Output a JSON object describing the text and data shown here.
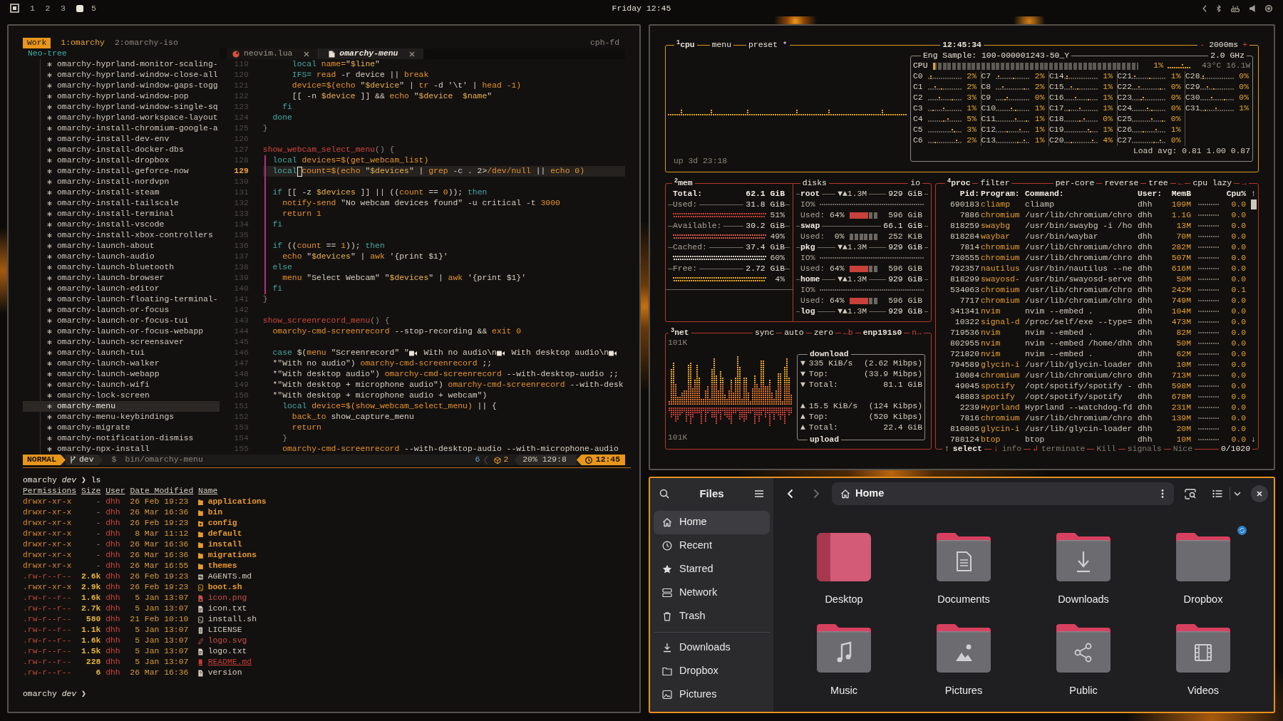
{
  "top_bar": {
    "workspaces": [
      {
        "label": "1",
        "selected": false
      },
      {
        "label": "2",
        "selected": false
      },
      {
        "label": "3",
        "selected": false
      },
      {
        "selected": true
      },
      {
        "label": "5",
        "selected": false
      }
    ],
    "clock": "Friday 12:45"
  },
  "tmux": {
    "session": "Work",
    "windows": [
      {
        "label": "1:omarchy",
        "selected": true
      },
      {
        "label": "2:omarchy-iso",
        "selected": false
      }
    ],
    "host": "cph-fd"
  },
  "neo_tree": {
    "title": "Neo-tree",
    "items": [
      {
        "name": "omarchy-hyprland-monitor-scaling-",
        "selected": false
      },
      {
        "name": "omarchy-hyprland-window-close-all",
        "selected": false
      },
      {
        "name": "omarchy-hyprland-window-gaps-togg",
        "selected": false
      },
      {
        "name": "omarchy-hyprland-window-pop",
        "selected": false
      },
      {
        "name": "omarchy-hyprland-window-single-sq",
        "selected": false
      },
      {
        "name": "omarchy-hyprland-workspace-layout",
        "selected": false
      },
      {
        "name": "omarchy-install-chromium-google-a",
        "selected": false
      },
      {
        "name": "omarchy-install-dev-env",
        "selected": false
      },
      {
        "name": "omarchy-install-docker-dbs",
        "selected": false
      },
      {
        "name": "omarchy-install-dropbox",
        "selected": false
      },
      {
        "name": "omarchy-install-geforce-now",
        "selected": false
      },
      {
        "name": "omarchy-install-nordvpn",
        "selected": false
      },
      {
        "name": "omarchy-install-steam",
        "selected": false
      },
      {
        "name": "omarchy-install-tailscale",
        "selected": false
      },
      {
        "name": "omarchy-install-terminal",
        "selected": false
      },
      {
        "name": "omarchy-install-vscode",
        "selected": false
      },
      {
        "name": "omarchy-install-xbox-controllers",
        "selected": false
      },
      {
        "name": "omarchy-launch-about",
        "selected": false
      },
      {
        "name": "omarchy-launch-audio",
        "selected": false
      },
      {
        "name": "omarchy-launch-bluetooth",
        "selected": false
      },
      {
        "name": "omarchy-launch-browser",
        "selected": false
      },
      {
        "name": "omarchy-launch-editor",
        "selected": false
      },
      {
        "name": "omarchy-launch-floating-terminal-",
        "selected": false
      },
      {
        "name": "omarchy-launch-or-focus",
        "selected": false
      },
      {
        "name": "omarchy-launch-or-focus-tui",
        "selected": false
      },
      {
        "name": "omarchy-launch-or-focus-webapp",
        "selected": false
      },
      {
        "name": "omarchy-launch-screensaver",
        "selected": false
      },
      {
        "name": "omarchy-launch-tui",
        "selected": false
      },
      {
        "name": "omarchy-launch-walker",
        "selected": false
      },
      {
        "name": "omarchy-launch-webapp",
        "selected": false
      },
      {
        "name": "omarchy-launch-wifi",
        "selected": false
      },
      {
        "name": "omarchy-lock-screen",
        "selected": false
      },
      {
        "name": "omarchy-menu",
        "selected": true
      },
      {
        "name": "omarchy-menu-keybindings",
        "selected": false
      },
      {
        "name": "omarchy-migrate",
        "selected": false
      },
      {
        "name": "omarchy-notification-dismiss",
        "selected": false
      },
      {
        "name": "omarchy-npx-install",
        "selected": false
      }
    ]
  },
  "editor": {
    "tabs": [
      {
        "label": "neovim.lua",
        "kind": "lua",
        "selected": false
      },
      {
        "label": "omarchy-menu",
        "kind": "shell",
        "selected": true
      }
    ],
    "lines": [
      {
        "number": "119",
        "current": false,
        "scope": false,
        "tokens": [
          {
            "kind": "kw",
            "text": "      local"
          },
          {
            "kind": "cmd",
            "text": " name="
          },
          {
            "kind": "txt",
            "text": "\""
          },
          {
            "kind": "var",
            "text": "$line"
          },
          {
            "kind": "txt",
            "text": "\""
          }
        ]
      },
      {
        "number": "120",
        "current": false,
        "scope": false,
        "tokens": [
          {
            "kind": "kw",
            "text": "      IFS="
          },
          {
            "kind": "cmd",
            "text": " read"
          },
          {
            "kind": "txt",
            "text": " -r device || "
          },
          {
            "kind": "cmd",
            "text": "break"
          }
        ]
      },
      {
        "number": "121",
        "current": false,
        "scope": false,
        "tokens": [
          {
            "kind": "cmd",
            "text": "      device=$(echo"
          },
          {
            "kind": "txt",
            "text": " \""
          },
          {
            "kind": "var",
            "text": "$device"
          },
          {
            "kind": "txt",
            "text": "\" | "
          },
          {
            "kind": "cmd",
            "text": "tr"
          },
          {
            "kind": "txt",
            "text": " -d '\\t' | "
          },
          {
            "kind": "cmd",
            "text": "head -1)"
          }
        ]
      },
      {
        "number": "122",
        "current": false,
        "scope": false,
        "tokens": [
          {
            "kind": "txt",
            "text": "      [[ -n "
          },
          {
            "kind": "var",
            "text": "$device"
          },
          {
            "kind": "txt",
            "text": " ]] && "
          },
          {
            "kind": "cmd",
            "text": "echo"
          },
          {
            "kind": "txt",
            "text": " \""
          },
          {
            "kind": "var",
            "text": "$device  $name"
          },
          {
            "kind": "txt",
            "text": "\""
          }
        ]
      },
      {
        "number": "123",
        "current": false,
        "scope": false,
        "tokens": [
          {
            "kind": "kw",
            "text": "    fi"
          }
        ]
      },
      {
        "number": "124",
        "current": false,
        "scope": false,
        "tokens": [
          {
            "kind": "kw",
            "text": "  done"
          }
        ]
      },
      {
        "number": "125",
        "current": false,
        "scope": false,
        "tokens": [
          {
            "kind": "dim",
            "text": "}"
          }
        ]
      },
      {
        "number": "126",
        "current": false,
        "scope": false
      },
      {
        "number": "127",
        "current": false,
        "scope": false,
        "tokens": [
          {
            "kind": "fn",
            "text": "show_webcam_select_menu"
          },
          {
            "kind": "dim",
            "text": "() {"
          }
        ]
      },
      {
        "number": "128",
        "current": false,
        "scope": true,
        "tokens": [
          {
            "kind": "kw",
            "text": "  local"
          },
          {
            "kind": "cmd",
            "text": " devices=$(get_webcam_list)"
          }
        ]
      },
      {
        "number": "129",
        "current": true,
        "scope": true,
        "tokens": [
          {
            "kind": "kw",
            "text": "  local"
          },
          {
            "kind": "cursor"
          },
          {
            "kind": "cmd",
            "text": "count=$(echo"
          },
          {
            "kind": "txt",
            "text": " \""
          },
          {
            "kind": "var",
            "text": "$devices"
          },
          {
            "kind": "txt",
            "text": "\" | "
          },
          {
            "kind": "cmd",
            "text": "grep"
          },
          {
            "kind": "txt",
            "text": " -c . 2>"
          },
          {
            "kind": "cmd",
            "text": "/dev/null"
          },
          {
            "kind": "txt",
            "text": " || "
          },
          {
            "kind": "cmd",
            "text": "echo 0)"
          }
        ]
      },
      {
        "number": "130",
        "current": false,
        "scope": true
      },
      {
        "number": "131",
        "current": false,
        "scope": true,
        "tokens": [
          {
            "kind": "kw",
            "text": "  if"
          },
          {
            "kind": "txt",
            "text": " [[ -z "
          },
          {
            "kind": "var",
            "text": "$devices"
          },
          {
            "kind": "txt",
            "text": " ]] || (("
          },
          {
            "kind": "cmd",
            "text": "count"
          },
          {
            "kind": "txt",
            "text": " == "
          },
          {
            "kind": "num",
            "text": "0"
          },
          {
            "kind": "txt",
            "text": "));"
          },
          {
            "kind": "kw",
            "text": " then"
          }
        ]
      },
      {
        "number": "132",
        "current": false,
        "scope": true,
        "tokens": [
          {
            "kind": "cmd",
            "text": "    notify-send"
          },
          {
            "kind": "txt",
            "text": " \"No webcam devices found\" -u critical -t "
          },
          {
            "kind": "num",
            "text": "3000"
          }
        ]
      },
      {
        "number": "133",
        "current": false,
        "scope": true,
        "tokens": [
          {
            "kind": "cmd",
            "text": "    return 1"
          }
        ]
      },
      {
        "number": "134",
        "current": false,
        "scope": true,
        "tokens": [
          {
            "kind": "kw",
            "text": "  fi"
          }
        ]
      },
      {
        "number": "135",
        "current": false,
        "scope": true
      },
      {
        "number": "136",
        "current": false,
        "scope": true,
        "tokens": [
          {
            "kind": "kw",
            "text": "  if"
          },
          {
            "kind": "txt",
            "text": " (("
          },
          {
            "kind": "cmd",
            "text": "count"
          },
          {
            "kind": "txt",
            "text": " == "
          },
          {
            "kind": "num",
            "text": "1"
          },
          {
            "kind": "txt",
            "text": "));"
          },
          {
            "kind": "kw",
            "text": " then"
          }
        ]
      },
      {
        "number": "137",
        "current": false,
        "scope": true,
        "tokens": [
          {
            "kind": "cmd",
            "text": "    echo"
          },
          {
            "kind": "txt",
            "text": " \""
          },
          {
            "kind": "var",
            "text": "$devices"
          },
          {
            "kind": "txt",
            "text": "\" | "
          },
          {
            "kind": "cmd",
            "text": "awk"
          },
          {
            "kind": "txt",
            "text": " '{print $1}'"
          }
        ]
      },
      {
        "number": "138",
        "current": false,
        "scope": true,
        "tokens": [
          {
            "kind": "kw",
            "text": "  else"
          }
        ]
      },
      {
        "number": "139",
        "current": false,
        "scope": true,
        "tokens": [
          {
            "kind": "cmd",
            "text": "    menu"
          },
          {
            "kind": "txt",
            "text": " \"Select Webcam\" \""
          },
          {
            "kind": "var",
            "text": "$devices"
          },
          {
            "kind": "txt",
            "text": "\" | "
          },
          {
            "kind": "cmd",
            "text": "awk"
          },
          {
            "kind": "txt",
            "text": " '{print $1}'"
          }
        ]
      },
      {
        "number": "140",
        "current": false,
        "scope": true,
        "tokens": [
          {
            "kind": "kw",
            "text": "  fi"
          }
        ]
      },
      {
        "number": "141",
        "current": false,
        "scope": false,
        "tokens": [
          {
            "kind": "dim",
            "text": "}"
          }
        ]
      },
      {
        "number": "142",
        "current": false,
        "scope": false
      },
      {
        "number": "143",
        "current": false,
        "scope": false,
        "tokens": [
          {
            "kind": "fn",
            "text": "show_screenrecord_menu"
          },
          {
            "kind": "dim",
            "text": "() {"
          }
        ]
      },
      {
        "number": "144",
        "current": false,
        "scope": false,
        "tokens": [
          {
            "kind": "cmd",
            "text": "  omarchy-cmd-screenrecord"
          },
          {
            "kind": "txt",
            "text": " --stop-recording && "
          },
          {
            "kind": "cmd",
            "text": "exit 0"
          }
        ]
      },
      {
        "number": "145",
        "current": false,
        "scope": false
      },
      {
        "number": "146",
        "current": false,
        "scope": false,
        "tokens": [
          {
            "kind": "kw",
            "text": "  case"
          },
          {
            "kind": "txt",
            "text": " $("
          },
          {
            "kind": "cmd",
            "text": "menu"
          },
          {
            "kind": "txt",
            "text": " \"Screenrecord\" \""
          },
          {
            "kind": "camera"
          },
          {
            "kind": "txt",
            "text": " With no audio\\n"
          },
          {
            "kind": "camera"
          },
          {
            "kind": "txt",
            "text": " With desktop audio\\n"
          },
          {
            "kind": "camera"
          }
        ]
      },
      {
        "number": "147",
        "current": false,
        "scope": false,
        "tokens": [
          {
            "kind": "txt",
            "text": "  *\"With no audio\")"
          },
          {
            "kind": "cmd",
            "text": " omarchy-cmd-screenrecord"
          },
          {
            "kind": "txt",
            "text": " ;;"
          }
        ]
      },
      {
        "number": "148",
        "current": false,
        "scope": false,
        "tokens": [
          {
            "kind": "txt",
            "text": "  *\"With desktop audio\")"
          },
          {
            "kind": "cmd",
            "text": " omarchy-cmd-screenrecord"
          },
          {
            "kind": "txt",
            "text": " --with-desktop-audio ;;"
          }
        ]
      },
      {
        "number": "149",
        "current": false,
        "scope": false,
        "tokens": [
          {
            "kind": "txt",
            "text": "  *\"With desktop + microphone audio\")"
          },
          {
            "kind": "cmd",
            "text": " omarchy-cmd-screenrecord"
          },
          {
            "kind": "txt",
            "text": " --with-desk"
          }
        ]
      },
      {
        "number": "150",
        "current": false,
        "scope": false,
        "tokens": [
          {
            "kind": "txt",
            "text": "  *\"With desktop + microphone audio + webcam\")"
          }
        ]
      },
      {
        "number": "151",
        "current": false,
        "scope": false,
        "tokens": [
          {
            "kind": "kw",
            "text": "    local"
          },
          {
            "kind": "cmd",
            "text": " device=$(show_webcam_select_menu)"
          },
          {
            "kind": "txt",
            "text": " || {"
          }
        ]
      },
      {
        "number": "152",
        "current": false,
        "scope": false,
        "tokens": [
          {
            "kind": "cmd",
            "text": "      back_to"
          },
          {
            "kind": "txt",
            "text": " show_capture_menu"
          }
        ]
      },
      {
        "number": "153",
        "current": false,
        "scope": false,
        "tokens": [
          {
            "kind": "cmd",
            "text": "      return"
          }
        ]
      },
      {
        "number": "154",
        "current": false,
        "scope": false,
        "tokens": [
          {
            "kind": "dim",
            "text": "    }"
          }
        ]
      },
      {
        "number": "155",
        "current": false,
        "scope": false,
        "tokens": [
          {
            "kind": "cmd",
            "text": "    omarchy-cmd-screenrecord"
          },
          {
            "kind": "txt",
            "text": " --with-desktop-audio --with-microphone-audio"
          }
        ]
      }
    ],
    "status_line": {
      "mode": "NORMAL",
      "branch": "dev",
      "file_icon": "$",
      "file": "bin/omarchy-menu",
      "diagnostics": "6",
      "packages": "2",
      "progress": "20%",
      "position": "129:8",
      "time": "12:45"
    }
  },
  "terminal": {
    "prompt": "omarchy *dev* ❯",
    "command": "ls",
    "columns": [
      "Permissions",
      "Size",
      "User",
      "Date Modified",
      "Name"
    ],
    "rows": [
      {
        "permissions": "drwxr-xr-x",
        "size": "-",
        "user": "dhh",
        "modified": "26 Feb 19:23",
        "name": "applications",
        "kind": "folder"
      },
      {
        "permissions": "drwxr-xr-x",
        "size": "-",
        "user": "dhh",
        "modified": "26 Mar 16:36",
        "name": "bin",
        "kind": "folder"
      },
      {
        "permissions": "drwxr-xr-x",
        "size": "-",
        "user": "dhh",
        "modified": "26 Feb 19:23",
        "name": "config",
        "kind": "config"
      },
      {
        "permissions": "drwxr-xr-x",
        "size": "-",
        "user": "dhh",
        "modified": "8 Mar 11:12",
        "name": "default",
        "kind": "folder"
      },
      {
        "permissions": "drwxr-xr-x",
        "size": "-",
        "user": "dhh",
        "modified": "26 Mar 16:36",
        "name": "install",
        "kind": "folder"
      },
      {
        "permissions": "drwxr-xr-x",
        "size": "-",
        "user": "dhh",
        "modified": "26 Mar 16:36",
        "name": "migrations",
        "kind": "folder"
      },
      {
        "permissions": "drwxr-xr-x",
        "size": "-",
        "user": "dhh",
        "modified": "26 Mar 16:55",
        "name": "themes",
        "kind": "folder"
      },
      {
        "permissions": ".rw-r--r--",
        "size": "2.6k",
        "user": "dhh",
        "modified": "26 Feb 19:23",
        "name": "AGENTS.md",
        "kind": "markdown"
      },
      {
        "permissions": ".rwxr-xr-x",
        "size": "2.9k",
        "user": "dhh",
        "modified": "26 Feb 19:23",
        "name": "boot.sh",
        "kind": "executable"
      },
      {
        "permissions": ".rw-r--r--",
        "size": "1.6k",
        "user": "dhh",
        "modified": "5 Jan 13:07",
        "name": "icon.png",
        "kind": "image"
      },
      {
        "permissions": ".rw-r--r--",
        "size": "2.7k",
        "user": "dhh",
        "modified": "5 Jan 13:07",
        "name": "icon.txt",
        "kind": "text"
      },
      {
        "permissions": ".rw-r--r--",
        "size": "580",
        "user": "dhh",
        "modified": "21 Feb 10:10",
        "name": "install.sh",
        "kind": "script"
      },
      {
        "permissions": ".rw-r--r--",
        "size": "1.1k",
        "user": "dhh",
        "modified": "5 Jan 13:07",
        "name": "LICENSE",
        "kind": "license"
      },
      {
        "permissions": ".rw-r--r--",
        "size": "1.6k",
        "user": "dhh",
        "modified": "5 Jan 13:07",
        "name": "logo.svg",
        "kind": "vector"
      },
      {
        "permissions": ".rw-r--r--",
        "size": "1.5k",
        "user": "dhh",
        "modified": "5 Jan 13:07",
        "name": "logo.txt",
        "kind": "text"
      },
      {
        "permissions": ".rw-r--r--",
        "size": "228",
        "user": "dhh",
        "modified": "5 Jan 13:07",
        "name": "README.md",
        "kind": "readme"
      },
      {
        "permissions": ".rw-r--r--",
        "size": "6",
        "user": "dhh",
        "modified": "26 Mar 16:36",
        "name": "version",
        "kind": "version"
      }
    ],
    "next_prompt": "omarchy *dev* ❯"
  },
  "btop": {
    "cpu": {
      "title": "$^{1}$cpu",
      "menu": "menu",
      "preset": "preset *",
      "clock": "12:45:34",
      "interval": {
        "decrease": "-",
        "value": "2000ms",
        "increase": "+"
      },
      "uptime": "up 3d 23:18",
      "model": "Eng Sample: 100-000001243-50_Y",
      "frequency": "2.0 GHz",
      "total": {
        "label": "CPU",
        "level": 0.01,
        "percent": "1%",
        "sensors": "43°C 16.1W"
      },
      "cores": [
        {
          "label": "C0",
          "percent": "2%"
        },
        {
          "label": "C1",
          "percent": "2%"
        },
        {
          "label": "C2",
          "percent": "3%"
        },
        {
          "label": "C3",
          "percent": "1%"
        },
        {
          "label": "C4",
          "percent": "5%"
        },
        {
          "label": "C5",
          "percent": "3%"
        },
        {
          "label": "C6",
          "percent": "2%"
        },
        {
          "label": "C7",
          "percent": "2%"
        },
        {
          "label": "C8",
          "percent": "2%"
        },
        {
          "label": "C9",
          "percent": "0%"
        },
        {
          "label": "C10",
          "percent": "1%"
        },
        {
          "label": "C11",
          "percent": "1%"
        },
        {
          "label": "C12",
          "percent": "1%"
        },
        {
          "label": "C13",
          "percent": "1%"
        },
        {
          "label": "C14",
          "percent": "1%"
        },
        {
          "label": "C15",
          "percent": "1%"
        },
        {
          "label": "C16",
          "percent": "1%"
        },
        {
          "label": "C17",
          "percent": "1%"
        },
        {
          "label": "C18",
          "percent": "0%"
        },
        {
          "label": "C19",
          "percent": "1%"
        },
        {
          "label": "C20",
          "percent": "4%"
        },
        {
          "label": "C21",
          "percent": "1%"
        },
        {
          "label": "C22",
          "percent": "0%"
        },
        {
          "label": "C23",
          "percent": "0%"
        },
        {
          "label": "C24",
          "percent": "0%"
        },
        {
          "label": "C25",
          "percent": "0%"
        },
        {
          "label": "C26",
          "percent": "1%"
        },
        {
          "label": "C27",
          "percent": "0%"
        },
        {
          "label": "C28",
          "percent": "0%"
        },
        {
          "label": "C29",
          "percent": "0%"
        },
        {
          "label": "C30",
          "percent": "0%"
        },
        {
          "label": "C31",
          "percent": "1%"
        }
      ],
      "load": "Load avg: 0.81 1.00 0.87"
    },
    "mem": {
      "title": "$^{2}$mem",
      "total": {
        "label": "Total:",
        "value": "62.1 GiB"
      },
      "rows": [
        {
          "label": "Used:",
          "value": "31.8 GiB",
          "percent": "51%",
          "color": "#c8413a"
        },
        {
          "label": "Available:",
          "value": "30.2 GiB",
          "percent": "49%",
          "color": "#d0584a"
        },
        {
          "label": "Cached:",
          "value": "37.4 GiB",
          "percent": "60%",
          "color": "#d8d2c8"
        },
        {
          "label": "Free:",
          "value": "2.72 GiB",
          "percent": "4%",
          "color": "#e8a524"
        }
      ]
    },
    "disks": {
      "title": "disks",
      "io_title": "io",
      "items": [
        {
          "name": "root",
          "io": "▼▲1.3M",
          "size": "929 GiB",
          "io_label": "IO%",
          "used_label": "Used:",
          "used": "64%",
          "level": 0.64,
          "free": "596 GiB"
        },
        {
          "name": "swap",
          "size": "66.1 GiB",
          "used_label": "Used:",
          "used": "0%",
          "level": 0,
          "free": "252 KiB"
        },
        {
          "name": "pkg",
          "io": "▼▲1.3M",
          "size": "929 GiB",
          "io_label": "IO%",
          "used_label": "Used:",
          "used": "64%",
          "level": 0.64,
          "free": "596 GiB"
        },
        {
          "name": "home",
          "io": "▼▲1.3M",
          "size": "929 GiB",
          "io_label": "IO%",
          "used_label": "Used:",
          "used": "64%",
          "level": 0.64,
          "free": "596 GiB"
        },
        {
          "name": "log",
          "io": "▼▲1.3M",
          "size": "929 GiB"
        }
      ]
    },
    "net": {
      "title": "$^{3}$net",
      "options": [
        "sync",
        "auto",
        "zero"
      ],
      "previous": "←b",
      "interface": "enp191s0",
      "next": "n→",
      "scale_top": "101K",
      "scale_bottom": "101K",
      "download": {
        "title": "download",
        "rows": [
          {
            "arrow": "▼",
            "label": "335 KiB/s",
            "value": "(2.62 Mibps)"
          },
          {
            "arrow": "▼",
            "label": "Top:",
            "value": "(33.9 Mibps)"
          },
          {
            "arrow": "▼",
            "label": "Total:",
            "value": "81.1 GiB"
          }
        ]
      },
      "upload": {
        "title": "upload",
        "rows": [
          {
            "arrow": "▲",
            "label": "15.5 KiB/s",
            "value": "(124 Kibps)"
          },
          {
            "arrow": "▲",
            "label": "Top:",
            "value": "(520 Kibps)"
          },
          {
            "arrow": "▲",
            "label": "Total:",
            "value": "22.4 GiB"
          }
        ]
      }
    },
    "proc": {
      "title": "$^{4}$proc",
      "options": [
        "filter",
        "per-core",
        "reverse",
        "tree"
      ],
      "sort": {
        "previous": "←",
        "label": "cpu lazy",
        "next": "→"
      },
      "columns": [
        "Pid:",
        "Program:",
        "Command:",
        "User:",
        "MemB",
        "Cpu%"
      ],
      "scroll_up": "↑",
      "scroll_down": "↓",
      "rows": [
        {
          "pid": "690183",
          "program": "cliamp",
          "command": "cliamp",
          "user": "dhh",
          "mem": "109M",
          "cpu": "0.0"
        },
        {
          "pid": "7886",
          "program": "chromium",
          "command": "/usr/lib/chromium/chro",
          "user": "dhh",
          "mem": "1.1G",
          "cpu": "0.0"
        },
        {
          "pid": "818259",
          "program": "swaybg",
          "command": "/usr/bin/swaybg -i /ho",
          "user": "dhh",
          "mem": "13M",
          "cpu": "0.0"
        },
        {
          "pid": "818284",
          "program": "waybar",
          "command": "/usr/bin/waybar",
          "user": "dhh",
          "mem": "70M",
          "cpu": "0.0"
        },
        {
          "pid": "7814",
          "program": "chromium",
          "command": "/usr/lib/chromium/chro",
          "user": "dhh",
          "mem": "282M",
          "cpu": "0.0"
        },
        {
          "pid": "730555",
          "program": "chromium",
          "command": "/usr/lib/chromium/chro",
          "user": "dhh",
          "mem": "507M",
          "cpu": "0.0"
        },
        {
          "pid": "792357",
          "program": "nautilus",
          "command": "/usr/bin/nautilus --ne",
          "user": "dhh",
          "mem": "616M",
          "cpu": "0.0"
        },
        {
          "pid": "818299",
          "program": "swayosd-",
          "command": "/usr/bin/swayosd-serve",
          "user": "dhh",
          "mem": "50M",
          "cpu": "0.0"
        },
        {
          "pid": "534063",
          "program": "chromium",
          "command": "/usr/lib/chromium/chro",
          "user": "dhh",
          "mem": "242M",
          "cpu": "0.1"
        },
        {
          "pid": "7717",
          "program": "chromium",
          "command": "/usr/lib/chromium/chro",
          "user": "dhh",
          "mem": "749M",
          "cpu": "0.0"
        },
        {
          "pid": "341341",
          "program": "nvim",
          "command": "nvim --embed .",
          "user": "dhh",
          "mem": "104M",
          "cpu": "0.0"
        },
        {
          "pid": "10322",
          "program": "signal-d",
          "command": "/proc/self/exe --type=",
          "user": "dhh",
          "mem": "473M",
          "cpu": "0.0"
        },
        {
          "pid": "719536",
          "program": "nvim",
          "command": "nvim --embed .",
          "user": "dhh",
          "mem": "82M",
          "cpu": "0.0"
        },
        {
          "pid": "802955",
          "program": "nvim",
          "command": "nvim --embed /home/dhh",
          "user": "dhh",
          "mem": "50M",
          "cpu": "0.0"
        },
        {
          "pid": "721820",
          "program": "nvim",
          "command": "nvim --embed .",
          "user": "dhh",
          "mem": "62M",
          "cpu": "0.0"
        },
        {
          "pid": "794589",
          "program": "glycin-i",
          "command": "/usr/lib/glycin-loader",
          "user": "dhh",
          "mem": "10M",
          "cpu": "0.0"
        },
        {
          "pid": "10084",
          "program": "chromium",
          "command": "/usr/lib/chromium/chro",
          "user": "dhh",
          "mem": "713M",
          "cpu": "0.0"
        },
        {
          "pid": "49045",
          "program": "spotify",
          "command": "/opt/spotify/spotify -",
          "user": "dhh",
          "mem": "598M",
          "cpu": "0.0"
        },
        {
          "pid": "48883",
          "program": "spotify",
          "command": "/opt/spotify/spotify",
          "user": "dhh",
          "mem": "678M",
          "cpu": "0.0"
        },
        {
          "pid": "2239",
          "program": "Hyprland",
          "command": "Hyprland --watchdog-fd",
          "user": "dhh",
          "mem": "231M",
          "cpu": "0.0"
        },
        {
          "pid": "7816",
          "program": "chromium",
          "command": "/usr/lib/chromium/chro",
          "user": "dhh",
          "mem": "139M",
          "cpu": "0.0"
        },
        {
          "pid": "810805",
          "program": "glycin-i",
          "command": "/usr/lib/glycin-loader",
          "user": "dhh",
          "mem": "20M",
          "cpu": "0.0"
        },
        {
          "pid": "788124",
          "program": "btop",
          "command": "btop",
          "user": "dhh",
          "mem": "10M",
          "cpu": "0.0"
        }
      ],
      "footer": [
        {
          "key": "↑",
          "label": "select",
          "disabled": false
        },
        {
          "key": "↓",
          "label": "info",
          "disabled": true
        },
        {
          "key": "↲",
          "label": "terminate",
          "disabled": true
        },
        {
          "label": "Kill",
          "disabled": true
        },
        {
          "label": "signals",
          "disabled": true
        },
        {
          "label": "Nice",
          "disabled": true
        }
      ],
      "count": "0/1020"
    }
  },
  "files": {
    "title": "Files",
    "places": [
      {
        "label": "Home",
        "kind": "home",
        "selected": true
      },
      {
        "label": "Recent",
        "kind": "recent",
        "selected": false
      },
      {
        "label": "Starred",
        "kind": "star",
        "selected": false
      },
      {
        "label": "Network",
        "kind": "network",
        "selected": false
      },
      {
        "label": "Trash",
        "kind": "trash",
        "selected": false
      }
    ],
    "bookmarks": [
      {
        "label": "Downloads",
        "kind": "download",
        "selected": false
      },
      {
        "label": "Dropbox",
        "kind": "folder",
        "selected": false
      },
      {
        "label": "Pictures",
        "kind": "picture",
        "selected": false
      }
    ],
    "back": {
      "disabled": false
    },
    "forward": {
      "disabled": true
    },
    "location": "Home",
    "items": [
      {
        "label": "Desktop",
        "kind": "desktop",
        "sync_badge": false
      },
      {
        "label": "Documents",
        "kind": "documents",
        "sync_badge": false
      },
      {
        "label": "Downloads",
        "kind": "downloads",
        "sync_badge": false
      },
      {
        "label": "Dropbox",
        "kind": "folder",
        "sync_badge": true
      },
      {
        "label": "Music",
        "kind": "music",
        "sync_badge": false
      },
      {
        "label": "Pictures",
        "kind": "pictures",
        "sync_badge": false
      },
      {
        "label": "Public",
        "kind": "public",
        "sync_badge": false
      },
      {
        "label": "Videos",
        "kind": "videos",
        "sync_badge": false
      }
    ]
  }
}
